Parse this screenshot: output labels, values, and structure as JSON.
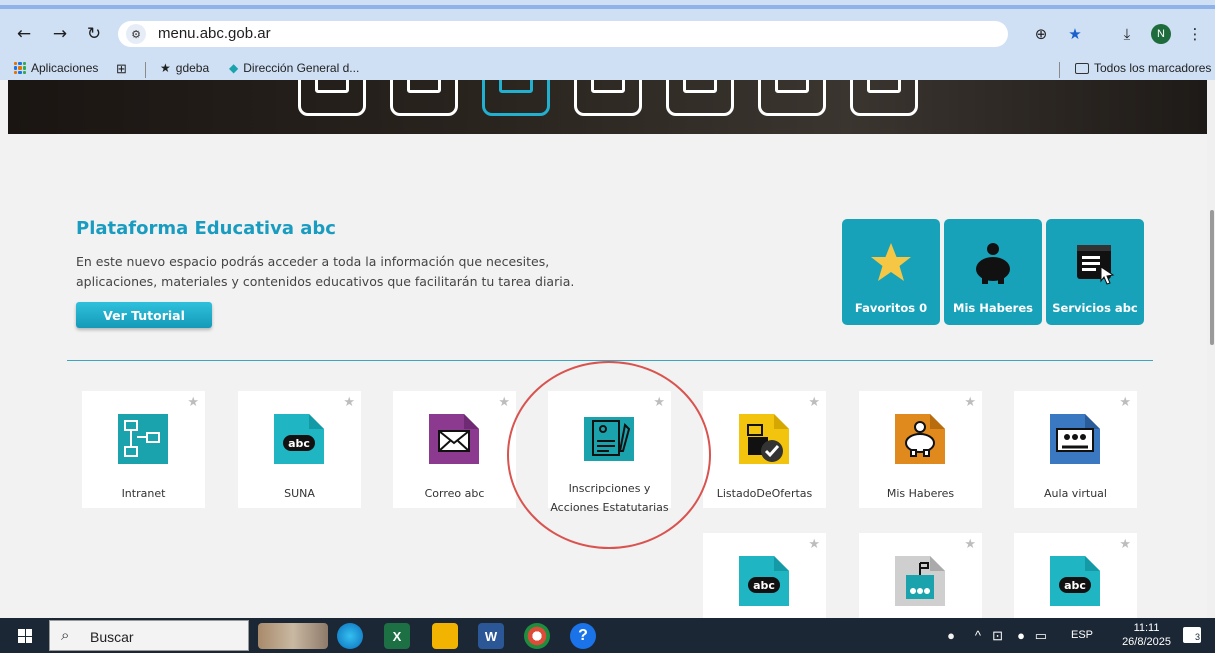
{
  "browser": {
    "url": "menu.abc.gob.ar",
    "profile_initial": "N",
    "bookmarks": {
      "apps_label": "Aplicaciones",
      "gdeba_label": "gdeba",
      "direccion_label": "Dirección General d...",
      "all_bookmarks_label": "Todos los marcadores"
    }
  },
  "page": {
    "title": "Plataforma Educativa abc",
    "description_line1": "En este nuevo espacio podrás acceder a toda la información que necesites,",
    "description_line2": "aplicaciones, materiales y contenidos educativos que facilitarán tu tarea diaria.",
    "tutorial_button": "Ver Tutorial",
    "quick_access": [
      {
        "label": "Favoritos 0",
        "icon": "star-icon"
      },
      {
        "label": "Mis Haberes",
        "icon": "piggy-bank-icon"
      },
      {
        "label": "Servicios abc",
        "icon": "services-screen-icon"
      }
    ],
    "tiles": [
      {
        "label": "Intranet",
        "icon": "network-icon",
        "color": "#1aa3ad"
      },
      {
        "label": "SUNA",
        "icon": "abc-logo-icon",
        "color": "#1fb5c2"
      },
      {
        "label": "Correo abc",
        "icon": "mail-icon",
        "color": "#8b3a8f"
      },
      {
        "label_line1": "Inscripciones y",
        "label_line2": "Acciones Estatutarias",
        "icon": "form-icon",
        "color": "#1aa3ad"
      },
      {
        "label": "ListadoDeOfertas",
        "icon": "job-listing-icon",
        "color": "#f2c40d"
      },
      {
        "label": "Mis Haberes",
        "icon": "piggy-bank-icon",
        "color": "#e08a1e"
      },
      {
        "label": "Aula virtual",
        "icon": "virtual-classroom-icon",
        "color": "#3a78c2"
      }
    ],
    "tiles_row2": [
      {
        "icon": "abc-logo-icon",
        "color": "#1fb5c2"
      },
      {
        "icon": "school-icon",
        "color": "#cfcfcf"
      },
      {
        "icon": "abc-logo-icon",
        "color": "#1fb5c2"
      }
    ]
  },
  "taskbar": {
    "search_placeholder": "Buscar",
    "language": "ESP",
    "time": "11:11",
    "date": "26/8/2025",
    "notification_count": "3"
  }
}
